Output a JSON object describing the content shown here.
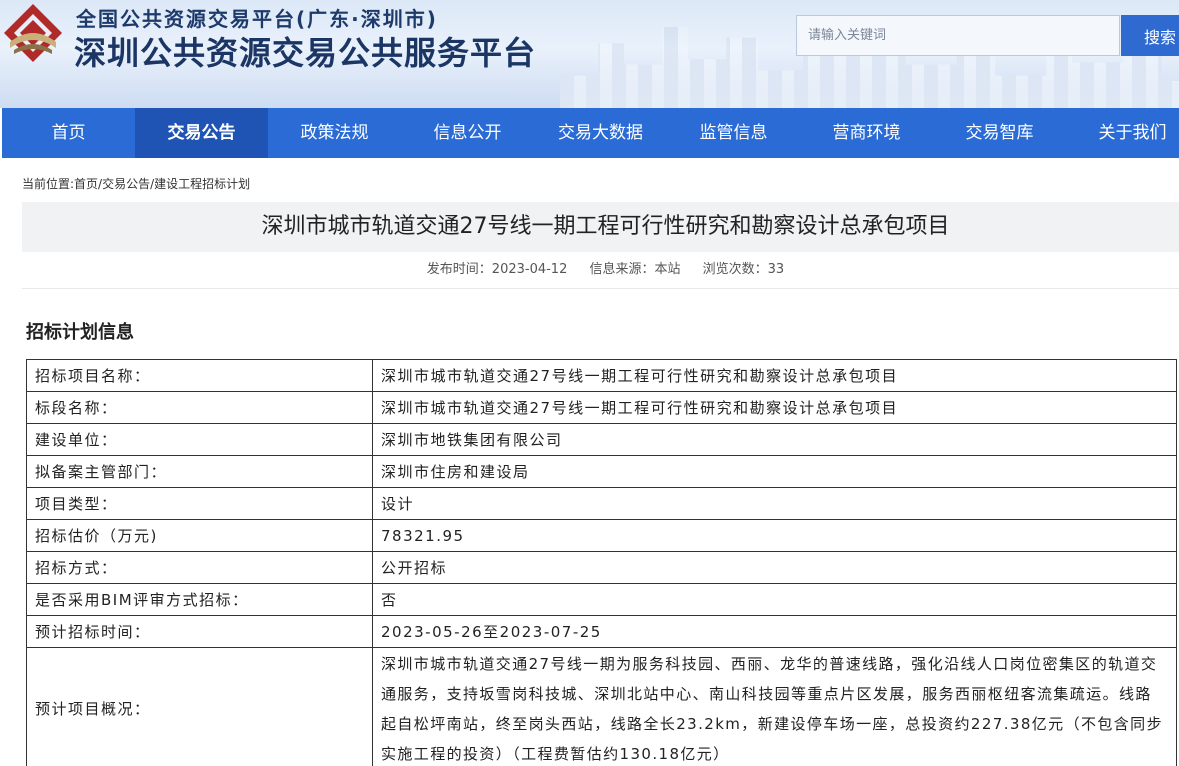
{
  "header": {
    "subtitle": "全国公共资源交易平台(广东·深圳市)",
    "title": "深圳公共资源交易公共服务平台",
    "logo_icon": "shenzhen-logo-icon",
    "search": {
      "placeholder": "请输入关键词",
      "button_label": "搜索"
    }
  },
  "nav": {
    "items": [
      {
        "label": "首页"
      },
      {
        "label": "交易公告",
        "active": true
      },
      {
        "label": "政策法规"
      },
      {
        "label": "信息公开"
      },
      {
        "label": "交易大数据"
      },
      {
        "label": "监管信息"
      },
      {
        "label": "营商环境"
      },
      {
        "label": "交易智库"
      },
      {
        "label": "关于我们"
      }
    ]
  },
  "breadcrumb": "当前位置:首页/交易公告/建设工程招标计划",
  "article": {
    "title": "深圳市城市轨道交通27号线一期工程可行性研究和勘察设计总承包项目",
    "publish_time": "发布时间：2023-04-12",
    "source": "信息来源：本站",
    "views": "浏览次数：33"
  },
  "section_title": "招标计划信息",
  "table": {
    "rows": [
      {
        "label": "招标项目名称：",
        "value": "深圳市城市轨道交通27号线一期工程可行性研究和勘察设计总承包项目"
      },
      {
        "label": "标段名称：",
        "value": "深圳市城市轨道交通27号线一期工程可行性研究和勘察设计总承包项目"
      },
      {
        "label": "建设单位：",
        "value": "深圳市地铁集团有限公司"
      },
      {
        "label": "拟备案主管部门：",
        "value": "深圳市住房和建设局"
      },
      {
        "label": "项目类型：",
        "value": "设计"
      },
      {
        "label": "招标估价（万元)",
        "value": "78321.95"
      },
      {
        "label": "招标方式：",
        "value": "公开招标"
      },
      {
        "label": "是否采用BIM评审方式招标：",
        "value": "否"
      },
      {
        "label": "预计招标时间：",
        "value": "2023-05-26至2023-07-25"
      },
      {
        "label": "预计项目概况：",
        "value": "深圳市城市轨道交通27号线一期为服务科技园、西丽、龙华的普速线路，强化沿线人口岗位密集区的轨道交通服务，支持坂雪岗科技城、深圳北站中心、南山科技园等重点片区发展，服务西丽枢纽客流集疏运。线路起自松坪南站，终至岗头西站，线路全长23.2km，新建设停车场一座，总投资约227.38亿元（不包含同步实施工程的投资）（工程费暂估约130.18亿元）"
      }
    ]
  }
}
